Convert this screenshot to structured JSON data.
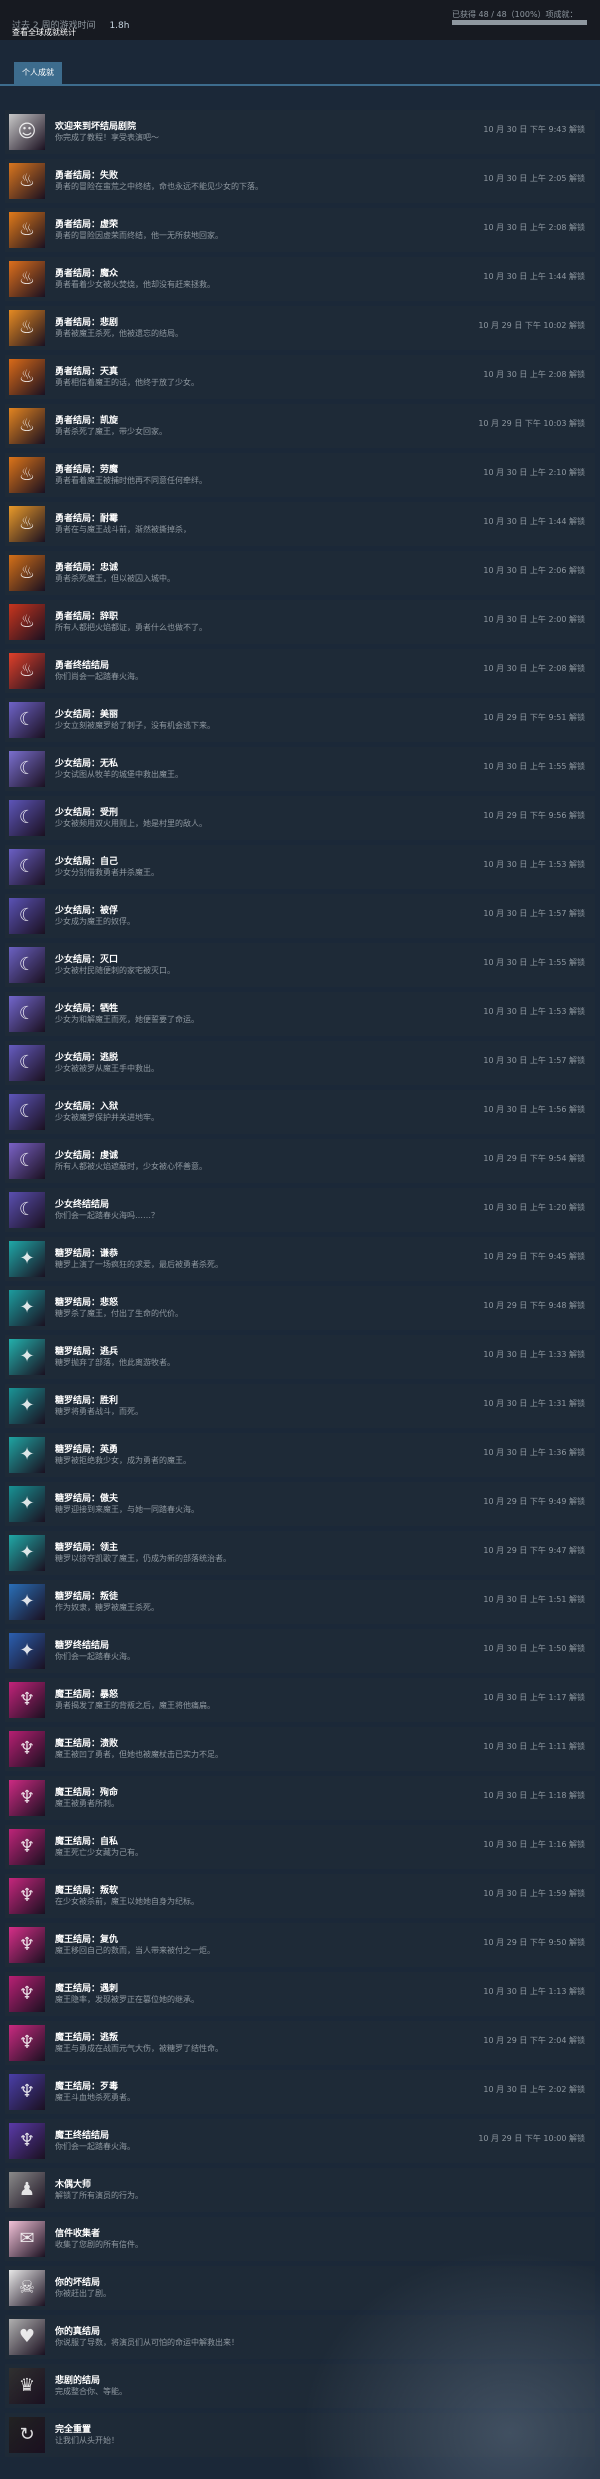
{
  "header": {
    "hours_label": "过去 2 周的游戏时间",
    "hours_value": "1.8h",
    "global_stats_link": "查看全球成就统计",
    "progress_text": "已获得 48 / 48（100%）项成就：",
    "progress_fraction": 1.0
  },
  "tabs": [
    {
      "label": "个人成就"
    }
  ],
  "achievements": [
    {
      "title": "欢迎来到坏结局剧院",
      "desc": "你完成了教程！享受表演吧～",
      "date": "10 月 30 日 下午 9:43 解锁",
      "color": "#c8c8c8",
      "icon": "mask-icon"
    },
    {
      "title": "勇者结局：失败",
      "desc": "勇者的冒险在蛮荒之中终结，命也永远不能见少女的下落。",
      "date": "10 月 30 日 上午 2:05 解锁",
      "color": "#d9761f",
      "icon": "flame-icon"
    },
    {
      "title": "勇者结局：虚荣",
      "desc": "勇者的冒险因虚荣而终结，他一无所获地回家。",
      "date": "10 月 30 日 上午 2:08 解锁",
      "color": "#e07a1a",
      "icon": "flame-icon"
    },
    {
      "title": "勇者结局：魔众",
      "desc": "勇者看着少女被火焚烧，他却没有赶来拯救。",
      "date": "10 月 30 日 上午 1:44 解锁",
      "color": "#dd6f1c",
      "icon": "flame-icon"
    },
    {
      "title": "勇者结局：悲剧",
      "desc": "勇者被魔王杀死，他被遗忘的结局。",
      "date": "10 月 29 日 下午 10:02 解锁",
      "color": "#e58a22",
      "icon": "flame-icon"
    },
    {
      "title": "勇者结局：天真",
      "desc": "勇者相信着魔王的话，他终于放了少女。",
      "date": "10 月 30 日 上午 2:08 解锁",
      "color": "#d96a18",
      "icon": "flame-icon"
    },
    {
      "title": "勇者结局：凯旋",
      "desc": "勇者杀死了魔王，带少女回家。",
      "date": "10 月 29 日 下午 10:03 解锁",
      "color": "#e28420",
      "icon": "flame-icon"
    },
    {
      "title": "勇者结局：劳魔",
      "desc": "勇者看着魔王被捕时他再不同意任何牵绊。",
      "date": "10 月 30 日 上午 2:10 解锁",
      "color": "#dc7419",
      "icon": "flame-icon"
    },
    {
      "title": "勇者结局：耐霉",
      "desc": "勇者在与魔王战斗前，渐然被撕掉杀，",
      "date": "10 月 30 日 上午 1:44 解锁",
      "color": "#e99a2a",
      "icon": "flame-icon"
    },
    {
      "title": "勇者结局：忠诚",
      "desc": "勇者杀死魔王，但以被囚入城中。",
      "date": "10 月 30 日 上午 2:06 解锁",
      "color": "#d47018",
      "icon": "flame-icon"
    },
    {
      "title": "勇者结局：辞职",
      "desc": "所有人都把火焰都证，勇者什么也做不了。",
      "date": "10 月 30 日 上午 2:00 解锁",
      "color": "#c8351e",
      "icon": "flame-icon"
    },
    {
      "title": "勇者终结结局",
      "desc": "你们尚会一起踏春火海。",
      "date": "10 月 30 日 上午 2:08 解锁",
      "color": "#e0402a",
      "icon": "flame-icon"
    },
    {
      "title": "少女结局：美丽",
      "desc": "少女立刻被魔罗给了刺子，没有机会逃下来。",
      "date": "10 月 29 日 下午 9:51 解锁",
      "color": "#6e63c8",
      "icon": "moon-icon"
    },
    {
      "title": "少女结局：无私",
      "desc": "少女试图从牧羊的城堡中救出魔王。",
      "date": "10 月 30 日 上午 1:55 解锁",
      "color": "#7a6fcf",
      "icon": "moon-icon"
    },
    {
      "title": "少女结局：受刑",
      "desc": "少女被频用双火用则上，她是村里的敌人。",
      "date": "10 月 29 日 下午 9:56 解锁",
      "color": "#5d55b8",
      "icon": "moon-icon"
    },
    {
      "title": "少女结局：自己",
      "desc": "少女分别借救勇者并杀魔王。",
      "date": "10 月 30 日 上午 1:53 解锁",
      "color": "#6a5fc4",
      "icon": "moon-icon"
    },
    {
      "title": "少女结局：被俘",
      "desc": "少女成为魔王的奴俘。",
      "date": "10 月 30 日 上午 1:57 解锁",
      "color": "#5a52b4",
      "icon": "moon-icon"
    },
    {
      "title": "少女结局：灭口",
      "desc": "少女被村民随便刺的家宅被灭口。",
      "date": "10 月 30 日 上午 1:55 解锁",
      "color": "#6b61c2",
      "icon": "moon-icon"
    },
    {
      "title": "少女结局：牺牲",
      "desc": "少女为和解魔王而死，她便誓要了命运。",
      "date": "10 月 30 日 上午 1:53 解锁",
      "color": "#7266cc",
      "icon": "moon-icon"
    },
    {
      "title": "少女结局：逃脱",
      "desc": "少女被被罗从魔王手中救出。",
      "date": "10 月 30 日 上午 1:57 解锁",
      "color": "#665cc0",
      "icon": "moon-icon"
    },
    {
      "title": "少女结局：入狱",
      "desc": "少女被魔罗保护并关进地牢。",
      "date": "10 月 30 日 上午 1:56 解锁",
      "color": "#5e56ba",
      "icon": "moon-icon"
    },
    {
      "title": "少女结局：虔诚",
      "desc": "所有人都被火焰遮蔽时，少女被心怀善意。",
      "date": "10 月 29 日 下午 9:54 解锁",
      "color": "#7a62c6",
      "icon": "moon-icon"
    },
    {
      "title": "少女终结结局",
      "desc": "你们会一起踏春火海吗……？",
      "date": "10 月 30 日 上午 1:20 解锁",
      "color": "#5a4fb0",
      "icon": "moon-icon"
    },
    {
      "title": "糖罗结局：谦恭",
      "desc": "糖罗上演了一场疯狂的求爱，最后被勇者杀死。",
      "date": "10 月 29 日 下午 9:45 解锁",
      "color": "#1fa8a8",
      "icon": "star-icon"
    },
    {
      "title": "糖罗结局：悲怒",
      "desc": "糖罗杀了魔王，付出了生命的代价。",
      "date": "10 月 29 日 下午 9:48 解锁",
      "color": "#1c9c9e",
      "icon": "star-icon"
    },
    {
      "title": "糖罗结局：逃兵",
      "desc": "糖罗抛弃了部落，他此离游牧者。",
      "date": "10 月 30 日 上午 1:33 解锁",
      "color": "#23b0ac",
      "icon": "star-icon"
    },
    {
      "title": "糖罗结局：胜利",
      "desc": "糖罗将勇者战斗，而死。",
      "date": "10 月 30 日 上午 1:31 解锁",
      "color": "#1a9496",
      "icon": "star-icon"
    },
    {
      "title": "糖罗结局：英勇",
      "desc": "糖罗被拒绝救少女，成为勇者的魔王。",
      "date": "10 月 30 日 上午 1:36 解锁",
      "color": "#1fa4a2",
      "icon": "star-icon"
    },
    {
      "title": "糖罗结局：傲夫",
      "desc": "糖罗迎接到来魔王，与她一同踏春火海。",
      "date": "10 月 29 日 下午 9:49 解锁",
      "color": "#189294",
      "icon": "star-icon"
    },
    {
      "title": "糖罗结局：领主",
      "desc": "糖罗以掠夺凯歌了魔王，仍成为新的部落统治者。",
      "date": "10 月 29 日 下午 9:47 解锁",
      "color": "#20a8a6",
      "icon": "star-icon"
    },
    {
      "title": "糖罗结局：叛徒",
      "desc": "作为奴隶，糖罗被魔王杀死。",
      "date": "10 月 30 日 上午 1:51 解锁",
      "color": "#2a6fb8",
      "icon": "star-icon"
    },
    {
      "title": "糖罗终结结局",
      "desc": "你们会一起踏春火海。",
      "date": "10 月 30 日 上午 1:50 解锁",
      "color": "#2b5fb0",
      "icon": "star-icon"
    },
    {
      "title": "魔王结局：暴怒",
      "desc": "勇者揭发了魔王的背叛之后，魔王将他痛扁。",
      "date": "10 月 30 日 上午 1:17 解锁",
      "color": "#c2237a",
      "icon": "horn-icon"
    },
    {
      "title": "魔王结局：溃败",
      "desc": "魔王被凹了勇者，但她也被魔杖击已实力不足。",
      "date": "10 月 30 日 上午 1:11 解锁",
      "color": "#b61f72",
      "icon": "horn-icon"
    },
    {
      "title": "魔王结局：殉命",
      "desc": "魔王被勇者所刺。",
      "date": "10 月 30 日 上午 1:18 解锁",
      "color": "#cc2a82",
      "icon": "horn-icon"
    },
    {
      "title": "魔王结局：自私",
      "desc": "魔王死亡少女藏为己有。",
      "date": "10 月 30 日 上午 1:16 解锁",
      "color": "#bd2478",
      "icon": "horn-icon"
    },
    {
      "title": "魔王结局：叛软",
      "desc": "在少女被杀前，魔王以她她自身为纪标。",
      "date": "10 月 30 日 上午 1:59 解锁",
      "color": "#c4267c",
      "icon": "horn-icon"
    },
    {
      "title": "魔王结局：复仇",
      "desc": "魔王移回自己的数而，当人带来被付之一炬。",
      "date": "10 月 29 日 下午 9:50 解锁",
      "color": "#d62e88",
      "icon": "horn-icon"
    },
    {
      "title": "魔王结局：遇刺",
      "desc": "魔王隐率，发现被罗正在篡位她的继承。",
      "date": "10 月 30 日 上午 1:13 解锁",
      "color": "#b82074",
      "icon": "horn-icon"
    },
    {
      "title": "魔王结局：逃叛",
      "desc": "魔王与勇成在战而元气大伤，被糖罗了结性命。",
      "date": "10 月 29 日 下午 2:04 解锁",
      "color": "#c92a80",
      "icon": "horn-icon"
    },
    {
      "title": "魔王结局：歹毒",
      "desc": "魔王斗血地杀死勇者。",
      "date": "10 月 30 日 上午 2:02 解锁",
      "color": "#4a3fa8",
      "icon": "horn-icon"
    },
    {
      "title": "魔王终结结局",
      "desc": "你们会一起踏春火海。",
      "date": "10 月 29 日 下午 10:00 解锁",
      "color": "#5a3aa8",
      "icon": "horn-icon"
    },
    {
      "title": "木偶大师",
      "desc": "解锁了所有演员的行为。",
      "date": "",
      "color": "#8a8a8a",
      "icon": "puppet-icon"
    },
    {
      "title": "信件收集者",
      "desc": "收集了您剧的所有信件。",
      "date": "",
      "color": "#f2c2d8",
      "icon": "letter-icon"
    },
    {
      "title": "你的坏结局",
      "desc": "你被赶出了剧。",
      "date": "",
      "color": "#e8e8e8",
      "icon": "skull-icon"
    },
    {
      "title": "你的真结局",
      "desc": "你说服了导数，将演员们从可怕的命运中解救出来！",
      "date": "",
      "color": "#b0b0b0",
      "icon": "heart-icon"
    },
    {
      "title": "悲剧的结局",
      "desc": "完成整合你、等能。",
      "date": "",
      "color": "#303030",
      "icon": "theater-icon"
    },
    {
      "title": "完全重置",
      "desc": "让我们从头开始！",
      "date": "",
      "color": "#222222",
      "icon": "reset-icon"
    }
  ]
}
